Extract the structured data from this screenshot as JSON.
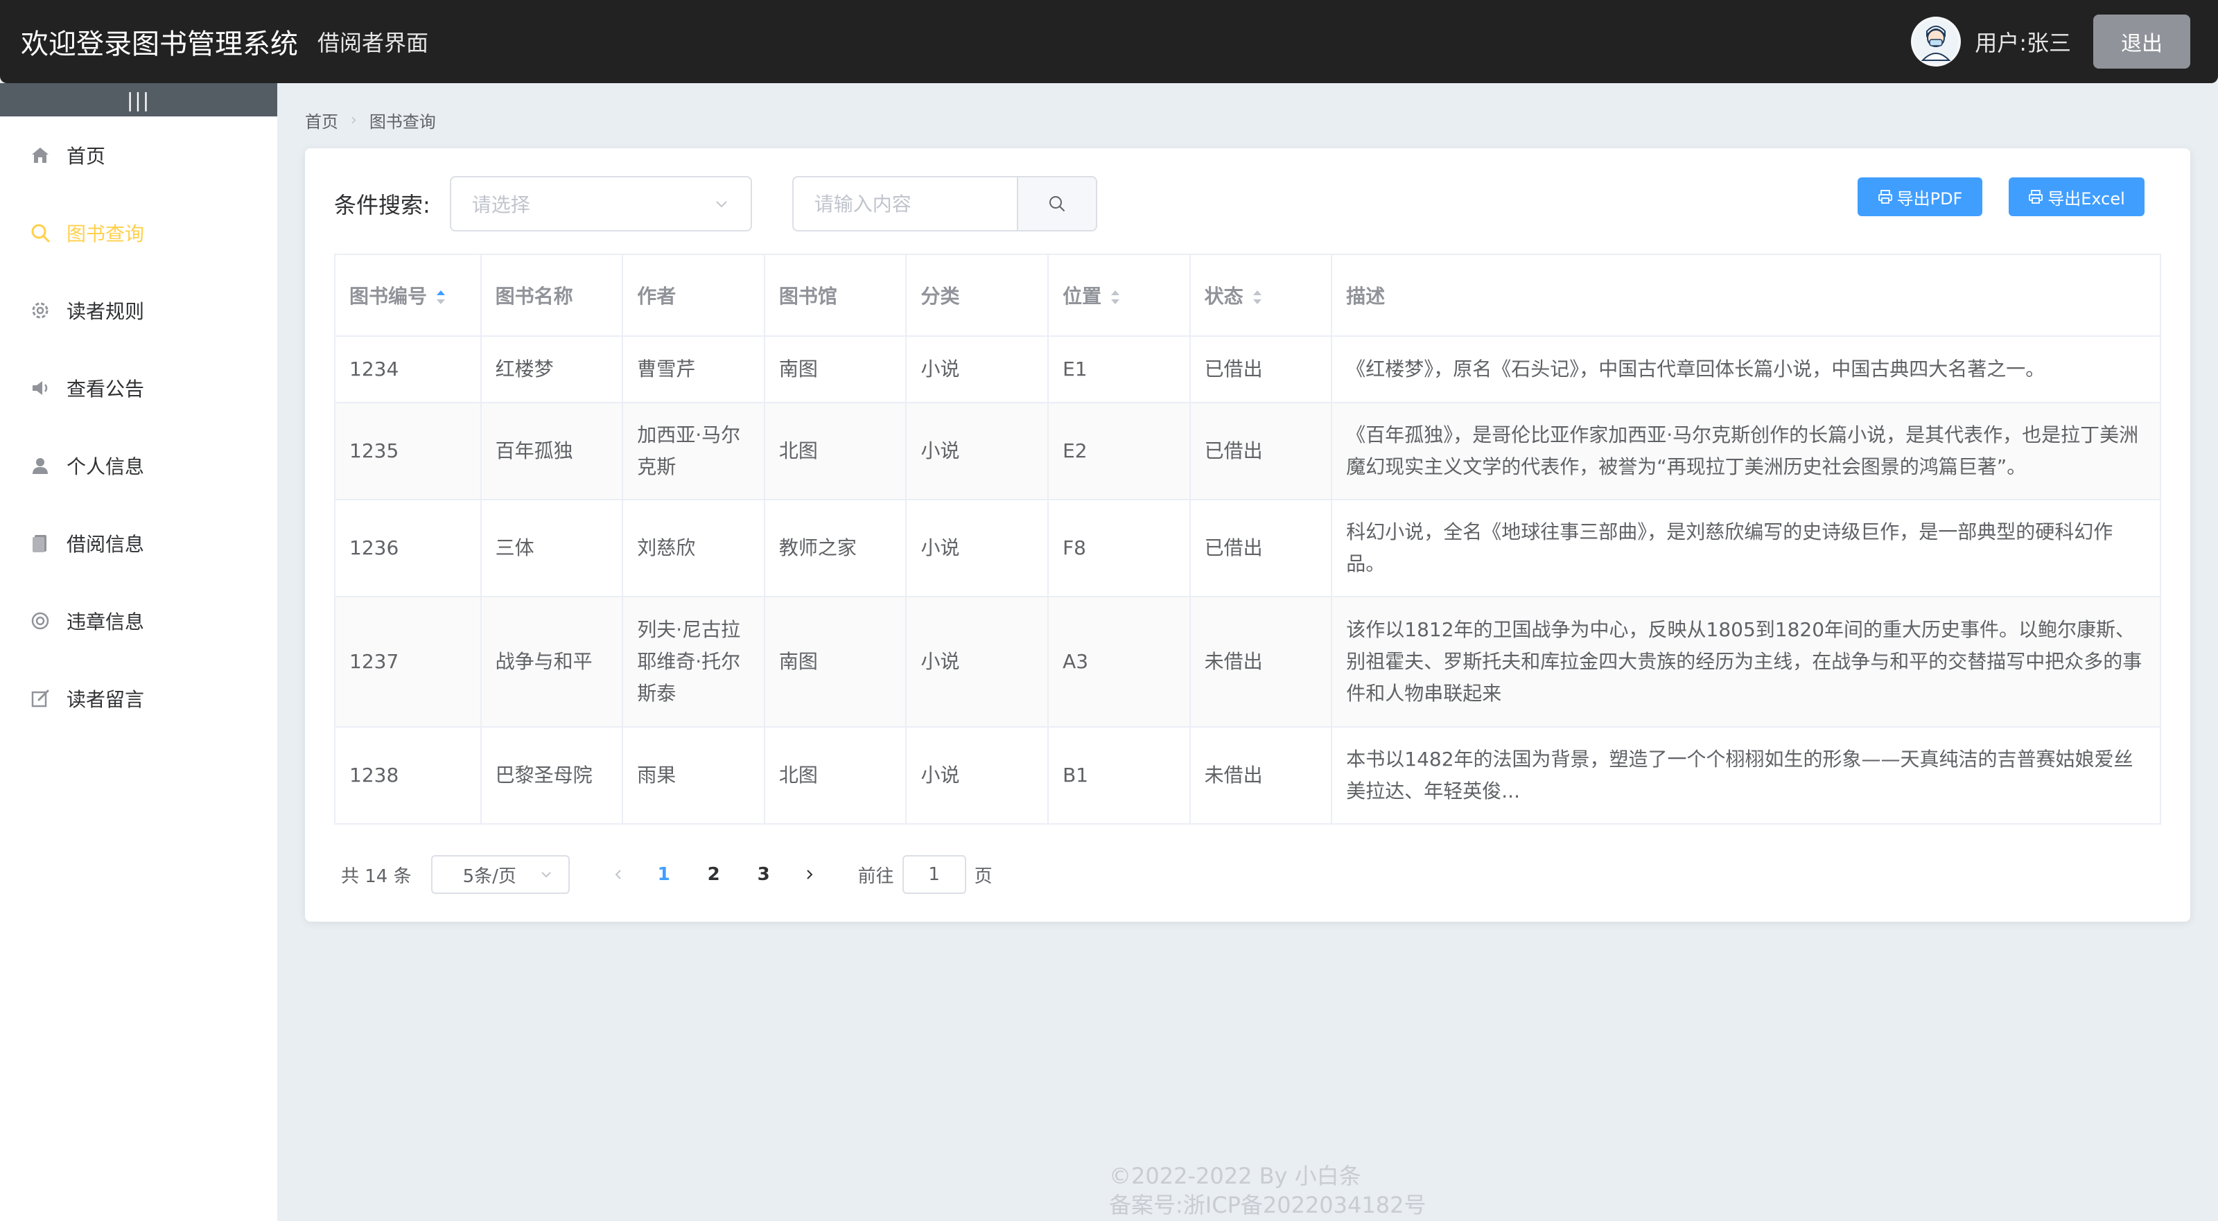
{
  "header": {
    "title": "欢迎登录图书管理系统",
    "subtitle": "借阅者界面",
    "user_label": "用户:张三",
    "logout_label": "退出"
  },
  "sidebar": {
    "collapse_icon": "|||",
    "items": [
      {
        "label": "首页",
        "icon": "home-icon",
        "active": false
      },
      {
        "label": "图书查询",
        "icon": "search-icon",
        "active": true
      },
      {
        "label": "读者规则",
        "icon": "gear-icon",
        "active": false
      },
      {
        "label": "查看公告",
        "icon": "speaker-icon",
        "active": false
      },
      {
        "label": "个人信息",
        "icon": "user-icon",
        "active": false
      },
      {
        "label": "借阅信息",
        "icon": "document-icon",
        "active": false
      },
      {
        "label": "违章信息",
        "icon": "warning-circle-icon",
        "active": false
      },
      {
        "label": "读者留言",
        "icon": "edit-icon",
        "active": false
      }
    ]
  },
  "breadcrumb": {
    "home": "首页",
    "current": "图书查询"
  },
  "search": {
    "label": "条件搜索:",
    "select_placeholder": "请选择",
    "input_placeholder": "请输入内容"
  },
  "actions": {
    "export_pdf": "导出PDF",
    "export_excel": "导出Excel"
  },
  "table": {
    "columns": [
      "图书编号",
      "图书名称",
      "作者",
      "图书馆",
      "分类",
      "位置",
      "状态",
      "描述"
    ],
    "rows": [
      [
        "1234",
        "红楼梦",
        "曹雪芹",
        "南图",
        "小说",
        "E1",
        "已借出",
        "《红楼梦》，原名《石头记》，中国古代章回体长篇小说，中国古典四大名著之一。"
      ],
      [
        "1235",
        "百年孤独",
        "加西亚·马尔克斯",
        "北图",
        "小说",
        "E2",
        "已借出",
        "《百年孤独》，是哥伦比亚作家加西亚·马尔克斯创作的长篇小说，是其代表作，也是拉丁美洲魔幻现实主义文学的代表作，被誉为“再现拉丁美洲历史社会图景的鸿篇巨著”。"
      ],
      [
        "1236",
        "三体",
        "刘慈欣",
        "教师之家",
        "小说",
        "F8",
        "已借出",
        "科幻小说，全名《地球往事三部曲》，是刘慈欣编写的史诗级巨作，是一部典型的硬科幻作品。"
      ],
      [
        "1237",
        "战争与和平",
        "列夫·尼古拉耶维奇·托尔斯泰",
        "南图",
        "小说",
        "A3",
        "未借出",
        "该作以1812年的卫国战争为中心，反映从1805到1820年间的重大历史事件。以鲍尔康斯、别祖霍夫、罗斯托夫和库拉金四大贵族的经历为主线，在战争与和平的交替描写中把众多的事件和人物串联起来"
      ],
      [
        "1238",
        "巴黎圣母院",
        "雨果",
        "北图",
        "小说",
        "B1",
        "未借出",
        "本书以1482年的法国为背景，塑造了一个个栩栩如生的形象——天真纯洁的吉普赛姑娘爱丝美拉达、年轻英俊..."
      ]
    ]
  },
  "pagination": {
    "total": "共 14 条",
    "page_size": "5条/页",
    "pages": [
      "1",
      "2",
      "3"
    ],
    "current_page": "1",
    "goto_prefix": "前往",
    "goto_value": "1",
    "goto_suffix": "页"
  },
  "footer": {
    "copyright": "©2022-2022 By 小白条",
    "icp": "备案号:浙ICP备2022034182号"
  },
  "colors": {
    "header_bg": "#222222",
    "active_menu": "#ffd04b",
    "primary": "#409eff",
    "logout_bg": "#909399"
  }
}
